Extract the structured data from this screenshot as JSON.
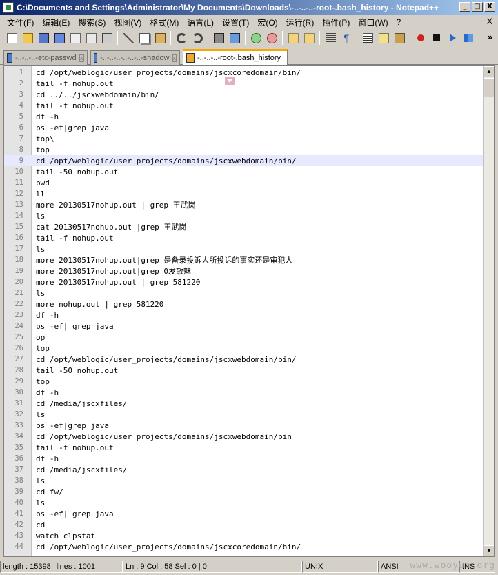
{
  "window": {
    "title": "C:\\Documents and Settings\\Administrator\\My Documents\\Downloads\\-..-..-..-root-.bash_history - Notepad++",
    "min": "_",
    "max": "□",
    "close": "X"
  },
  "menu": {
    "items": [
      "文件(F)",
      "编辑(E)",
      "搜索(S)",
      "视图(V)",
      "格式(M)",
      "语言(L)",
      "设置(T)",
      "宏(O)",
      "运行(R)",
      "插件(P)",
      "窗口(W)",
      "?"
    ],
    "close": "X"
  },
  "toolbar": {
    "icons": [
      "new-file-icon",
      "open-file-icon",
      "save-icon",
      "save-all-icon",
      "close-file-icon",
      "close-all-icon",
      "print-icon",
      "cut-icon",
      "copy-icon",
      "paste-icon",
      "undo-icon",
      "redo-icon",
      "find-icon",
      "replace-icon",
      "zoom-in-icon",
      "zoom-out-icon",
      "sync-v-icon",
      "sync-h-icon",
      "wrap-icon",
      "all-chars-icon",
      "indent-guide-icon",
      "user-lang-icon",
      "doc-map-icon",
      "record-macro-icon",
      "stop-macro-icon",
      "play-macro-icon",
      "run-macro-multiple-icon"
    ],
    "more": "»"
  },
  "tabs": [
    {
      "label": "-..-..-..-etc-passwd",
      "active": false
    },
    {
      "label": "-..-..-..-..-..-..-shadow",
      "active": false
    },
    {
      "label": "-..-..-..-root-.bash_history",
      "active": true
    }
  ],
  "editor": {
    "current_line": 9,
    "lines": [
      "cd /opt/weblogic/user_projects/domains/jscxcoredomain/bin/",
      "tail -f nohup.out",
      "cd ../../jscxwebdomain/bin/",
      "tail -f nohup.out",
      "df -h",
      "ps -ef|grep java",
      "top\\",
      "top",
      "cd /opt/weblogic/user_projects/domains/jscxwebdomain/bin/",
      "tail -50 nohup.out",
      "pwd",
      "ll",
      "more 20130517nohup.out | grep 王武岗",
      "ls",
      "cat 20130517nohup.out |grep 王武岗",
      "tail -f nohup.out",
      "ls",
      "more 20130517nohup.out|grep 是备录投诉人所投诉的事实还是审犯人",
      "more 20130517nohup.out|grep 0发散魅",
      "more 20130517nohup.out | grep 581220",
      "ls",
      "more nohup.out | grep 581220",
      "df -h",
      "ps -ef| grep java",
      "op",
      "top",
      "cd /opt/weblogic/user_projects/domains/jscxwebdomain/bin/",
      "tail -50 nohup.out",
      "top",
      "df -h",
      "cd /media/jscxfiles/",
      "ls",
      "ps -ef|grep java",
      "cd /opt/weblogic/user_projects/domains/jscxwebdomain/bin",
      "tail -f nohup.out",
      "df -h",
      "cd /media/jscxfiles/",
      "ls",
      "cd fw/",
      "ls",
      "ps -ef| grep java",
      "cd",
      "watch clpstat",
      "cd /opt/weblogic/user_projects/domains/jscxcoredomain/bin/"
    ]
  },
  "status": {
    "length": "length : 15398",
    "lines": "lines : 1001",
    "position": "Ln : 9    Col : 58    Sel : 0 | 0",
    "eol": "UNIX",
    "encoding": "ANSI",
    "mode": "INS"
  },
  "watermark": "www.wooyun.org"
}
